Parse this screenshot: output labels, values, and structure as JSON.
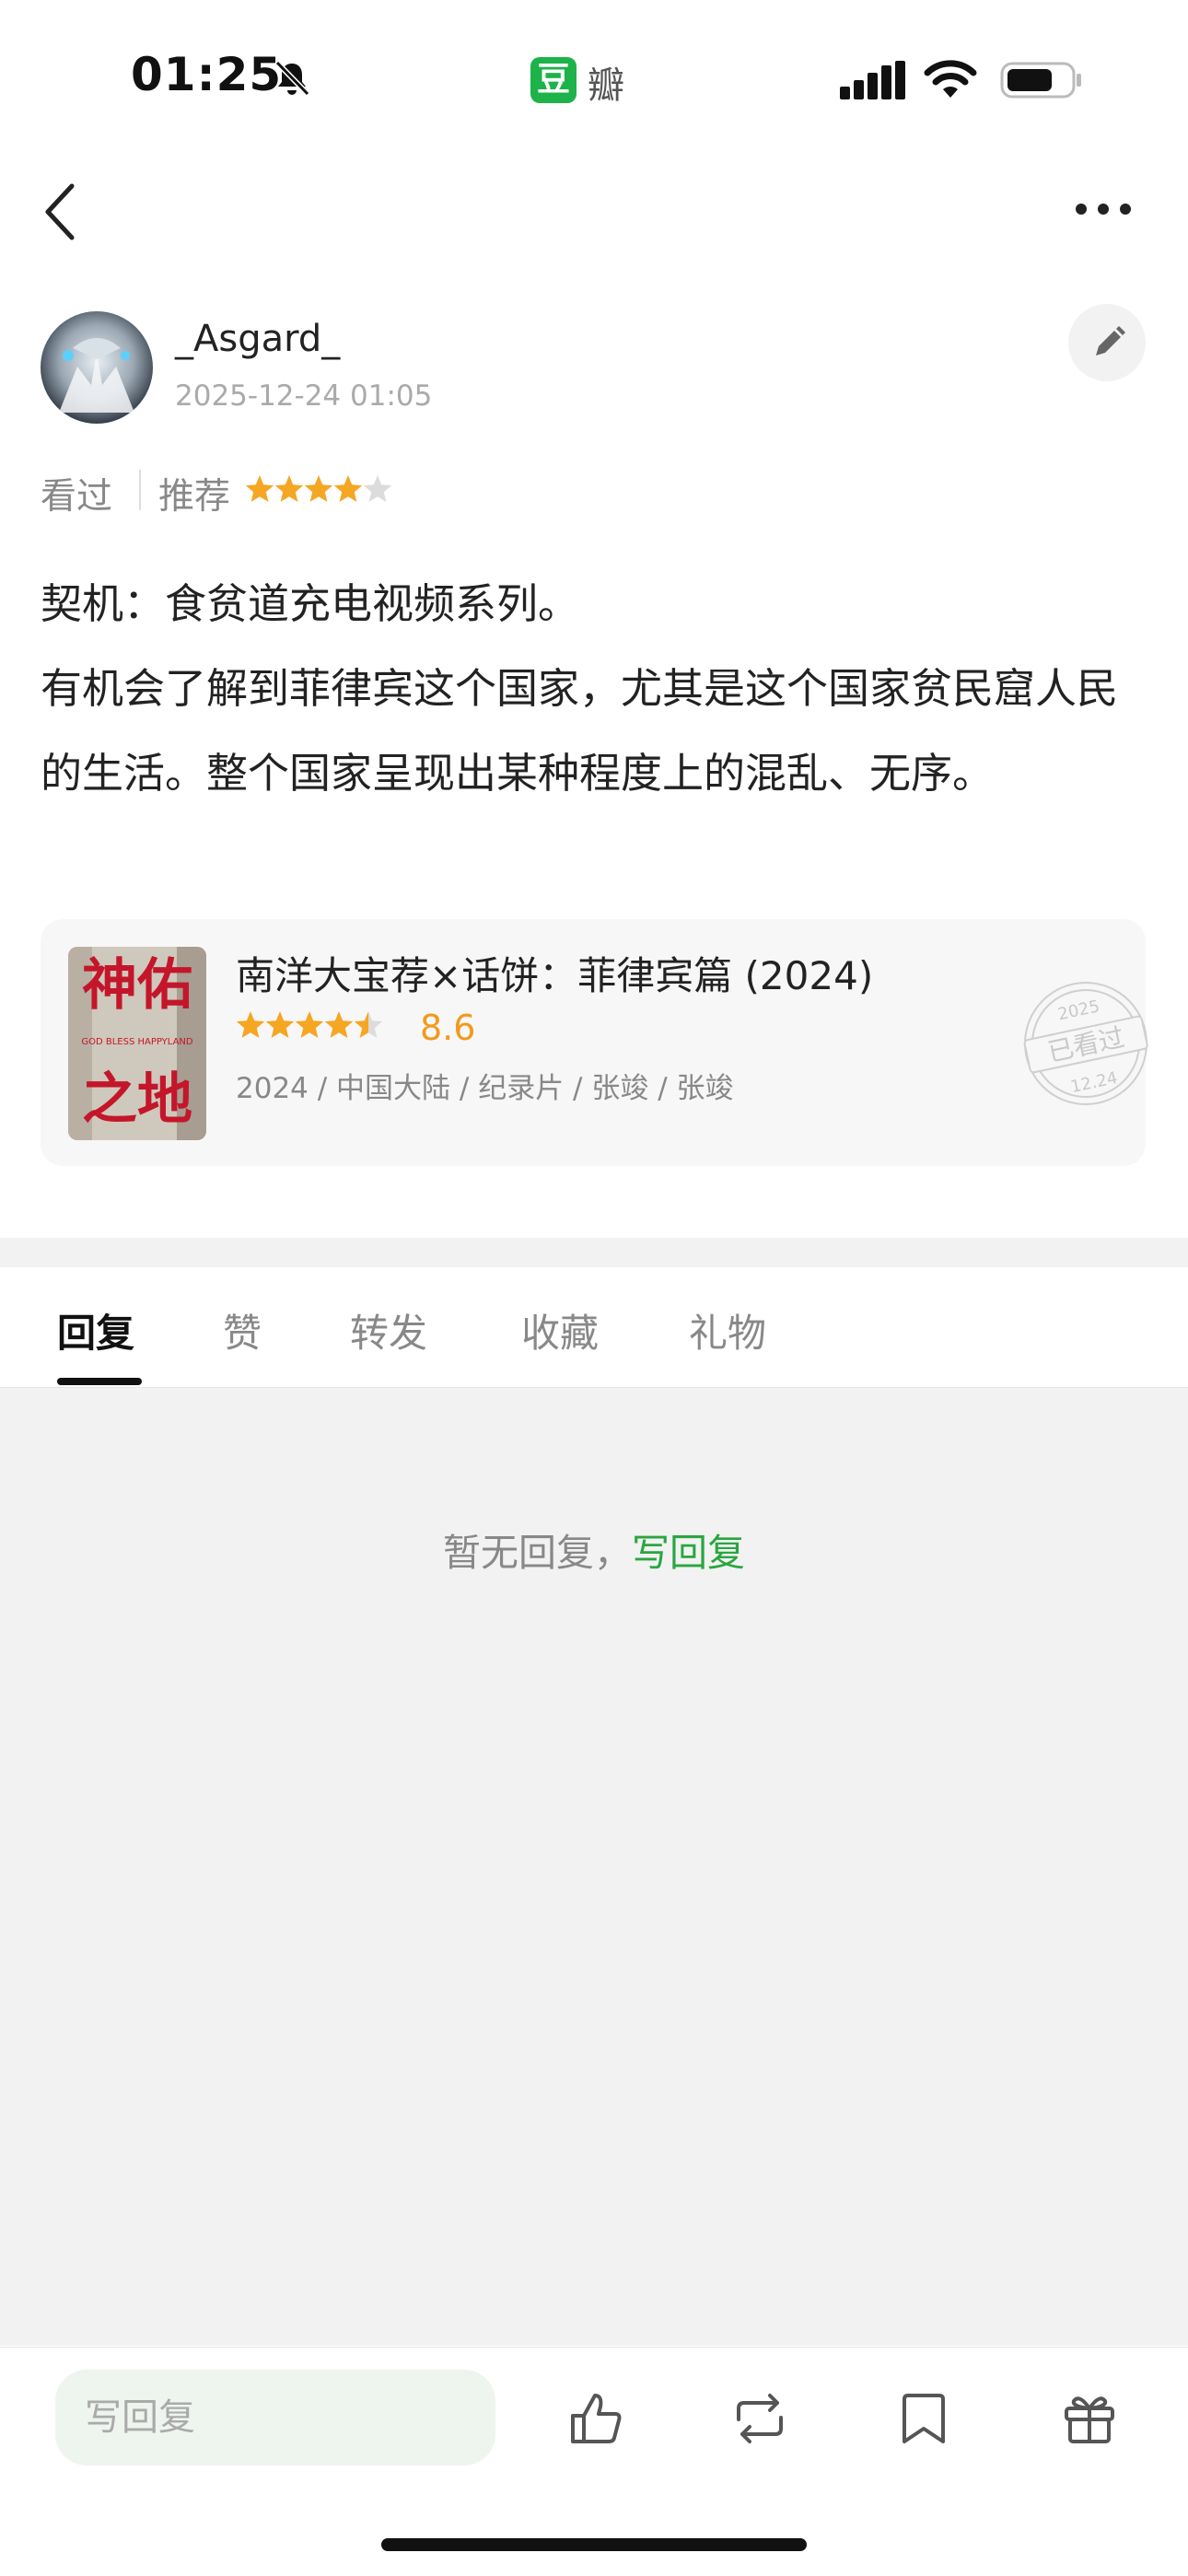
{
  "status_bar": {
    "time": "01:25",
    "app_badge": "豆",
    "app_name": "瓣"
  },
  "author": {
    "name": "_Asgard_",
    "date": "2025-12-24 01:05"
  },
  "status": {
    "seen": "看过",
    "recommend": "推荐",
    "user_rating": 4,
    "user_rating_max": 5
  },
  "review": {
    "lines": [
      "契机：食贫道充电视频系列。",
      "有机会了解到菲律宾这个国家，尤其是这个国家贫民窟人民的生活。整个国家呈现出某种程度上的混乱、无序。"
    ]
  },
  "movie": {
    "title": "南洋大宝荐×话饼：菲律宾篇 (2024)",
    "rating": "8.6",
    "star_level": 4.5,
    "meta": "2024 / 中国大陆 / 纪录片 / 张竣 / 张竣",
    "poster_text_1": "神佑",
    "poster_text_2": "之地",
    "poster_subtitle": "GOD BLESS HAPPYLAND",
    "stamp_year": "2025",
    "stamp_label": "已看过",
    "stamp_date": "12.24"
  },
  "tabs": [
    {
      "label": "回复"
    },
    {
      "label": "赞"
    },
    {
      "label": "转发"
    },
    {
      "label": "收藏"
    },
    {
      "label": "礼物"
    }
  ],
  "empty_state": {
    "text": "暂无回复，",
    "link": "写回复"
  },
  "bottom_bar": {
    "reply_placeholder": "写回复"
  },
  "colors": {
    "accent_green": "#2aa640",
    "star_orange": "#f5a623",
    "rating_orange": "#f29a1d"
  }
}
